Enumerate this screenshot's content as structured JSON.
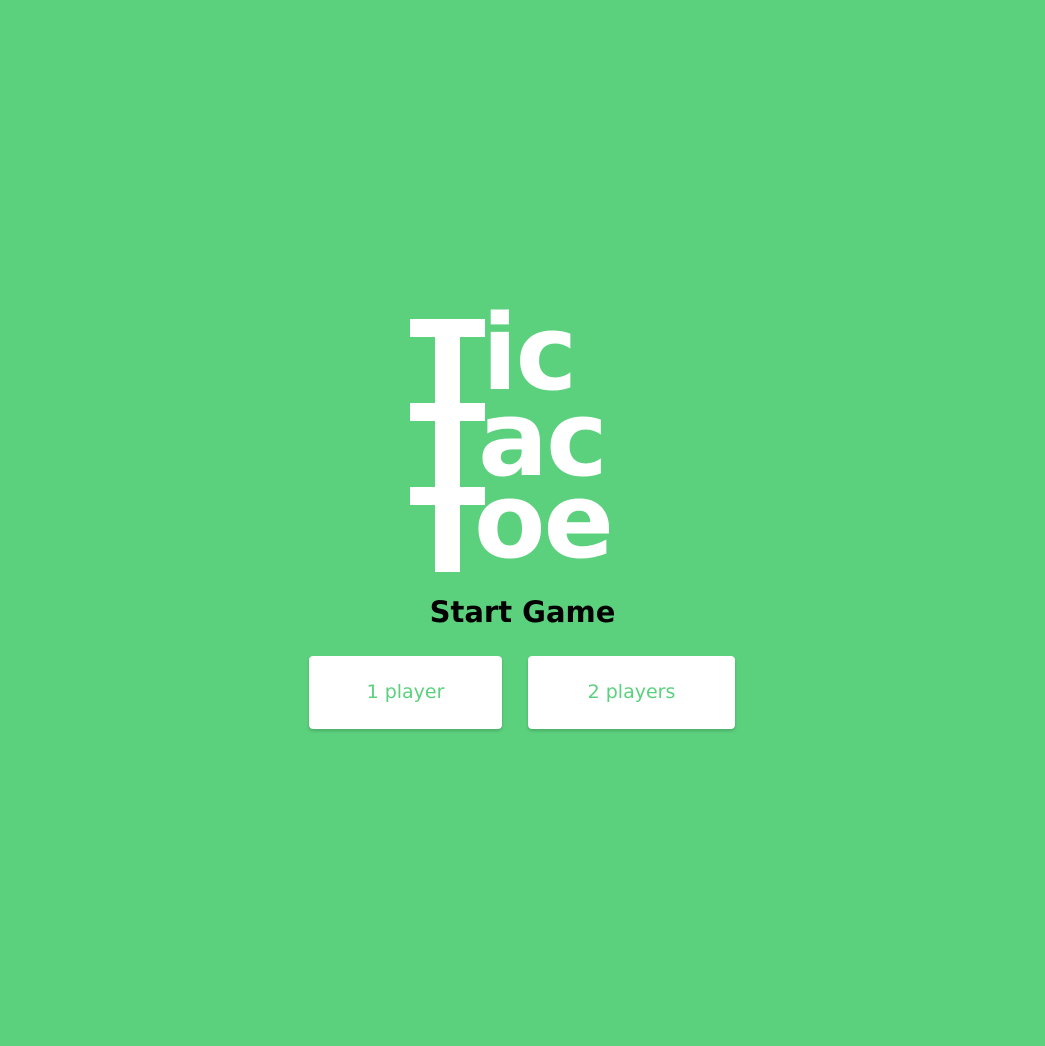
{
  "theme": {
    "background": "#5bd17d",
    "accent": "#5bd17d",
    "button_bg": "#ffffff",
    "title_color": "#000000"
  },
  "logo": {
    "line1": "ic",
    "line2": "ac",
    "line3": "oe"
  },
  "start_screen": {
    "title": "Start Game",
    "buttons": {
      "one_player": "1 player",
      "two_players": "2 players"
    }
  }
}
